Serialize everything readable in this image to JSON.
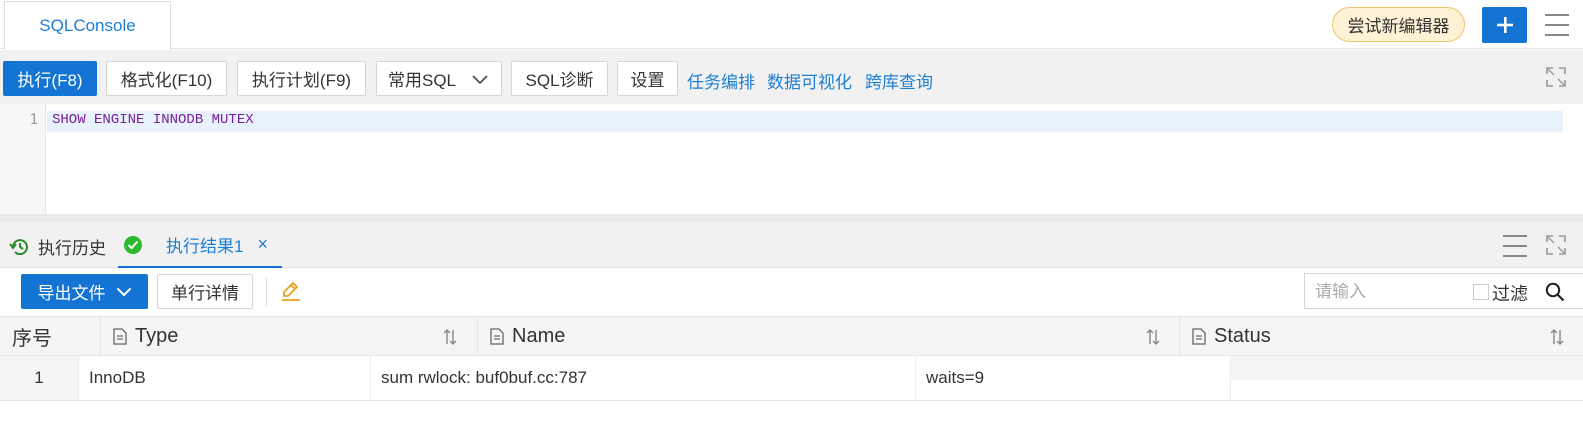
{
  "tabbar": {
    "active_tab": "SQLConsole",
    "try_new_editor": "尝试新编辑器",
    "add_icon": "plus-icon",
    "menu_icon": "hamburger-menu-icon"
  },
  "toolbar": {
    "execute": "执行(F8)",
    "format": "格式化(F10)",
    "plan": "执行计划(F9)",
    "common_sql": "常用SQL",
    "diagnose": "SQL诊断",
    "settings": "设置",
    "links": [
      "任务编排",
      "数据可视化",
      "跨库查询"
    ]
  },
  "editor": {
    "line_number": "1",
    "code": "SHOW ENGINE INNODB MUTEX"
  },
  "results": {
    "history_tab": "执行历史",
    "result_tab": "执行结果1",
    "close_symbol": "×",
    "export_btn": "导出文件",
    "detail_btn": "单行详情",
    "search_placeholder": "请输入",
    "filter_label": "过滤"
  },
  "table": {
    "columns": [
      "序号",
      "Type",
      "Name",
      "Status"
    ],
    "rows": [
      {
        "idx": "1",
        "type": "InnoDB",
        "name": "sum rwlock: buf0buf.cc:787",
        "status": "waits=9"
      }
    ]
  },
  "colors": {
    "primary": "#1474d4",
    "link": "#1e7fd4",
    "success": "#2eb82e",
    "keyword": "#7a1e9a",
    "edit_icon": "#e9a21b"
  }
}
